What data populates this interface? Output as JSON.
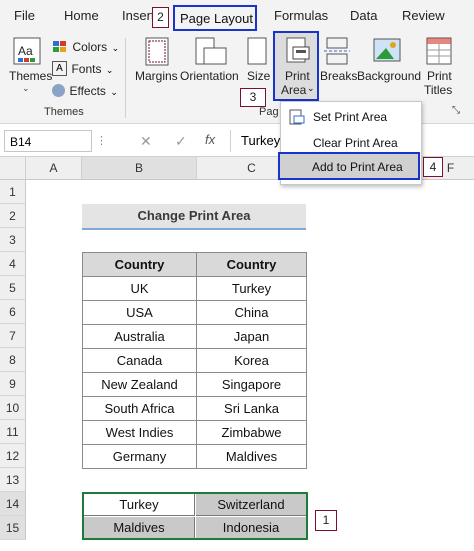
{
  "tabs": [
    "File",
    "Home",
    "Insert",
    "Page Layout",
    "Formulas",
    "Data",
    "Review"
  ],
  "ribbon": {
    "themes": "Themes",
    "colors": "Colors",
    "fonts": "Fonts",
    "effects": "Effects",
    "themes_group": "Themes",
    "margins": "Margins",
    "orientation": "Orientation",
    "size": "Size",
    "print_area": "Print",
    "print_area2": "Area",
    "breaks": "Breaks",
    "background": "Background",
    "print_titles1": "Print",
    "print_titles2": "Titles",
    "page_group": "Pag"
  },
  "menu": {
    "set": "Set Print Area",
    "clear": "Clear Print Area",
    "add": "Add to Print Area"
  },
  "formula": {
    "name_box": "B14",
    "fx": "fx",
    "value": "Turkey"
  },
  "badges": {
    "b1": "1",
    "b2": "2",
    "b3": "3",
    "b4": "4"
  },
  "columns": [
    "A",
    "B",
    "C",
    "F"
  ],
  "rows": [
    "1",
    "2",
    "3",
    "4",
    "5",
    "6",
    "7",
    "8",
    "9",
    "10",
    "11",
    "12",
    "13",
    "14",
    "15"
  ],
  "sheet": {
    "title": "Change Print Area",
    "headers": [
      "Country",
      "Country"
    ],
    "table": [
      [
        "UK",
        "Turkey"
      ],
      [
        "USA",
        "China"
      ],
      [
        "Australia",
        "Japan"
      ],
      [
        "Canada",
        "Korea"
      ],
      [
        "New Zealand",
        "Singapore"
      ],
      [
        "South Africa",
        "Sri Lanka"
      ],
      [
        "West Indies",
        "Zimbabwe"
      ],
      [
        "Germany",
        "Maldives"
      ]
    ],
    "selection": [
      [
        "Turkey",
        "Switzerland"
      ],
      [
        "Maldives",
        "Indonesia"
      ]
    ]
  },
  "colors": {
    "accent_box": "#1a33c8",
    "badge_border": "#7a1030",
    "header_fill": "#d9d9d9",
    "selection_border": "#1e7b3a"
  }
}
